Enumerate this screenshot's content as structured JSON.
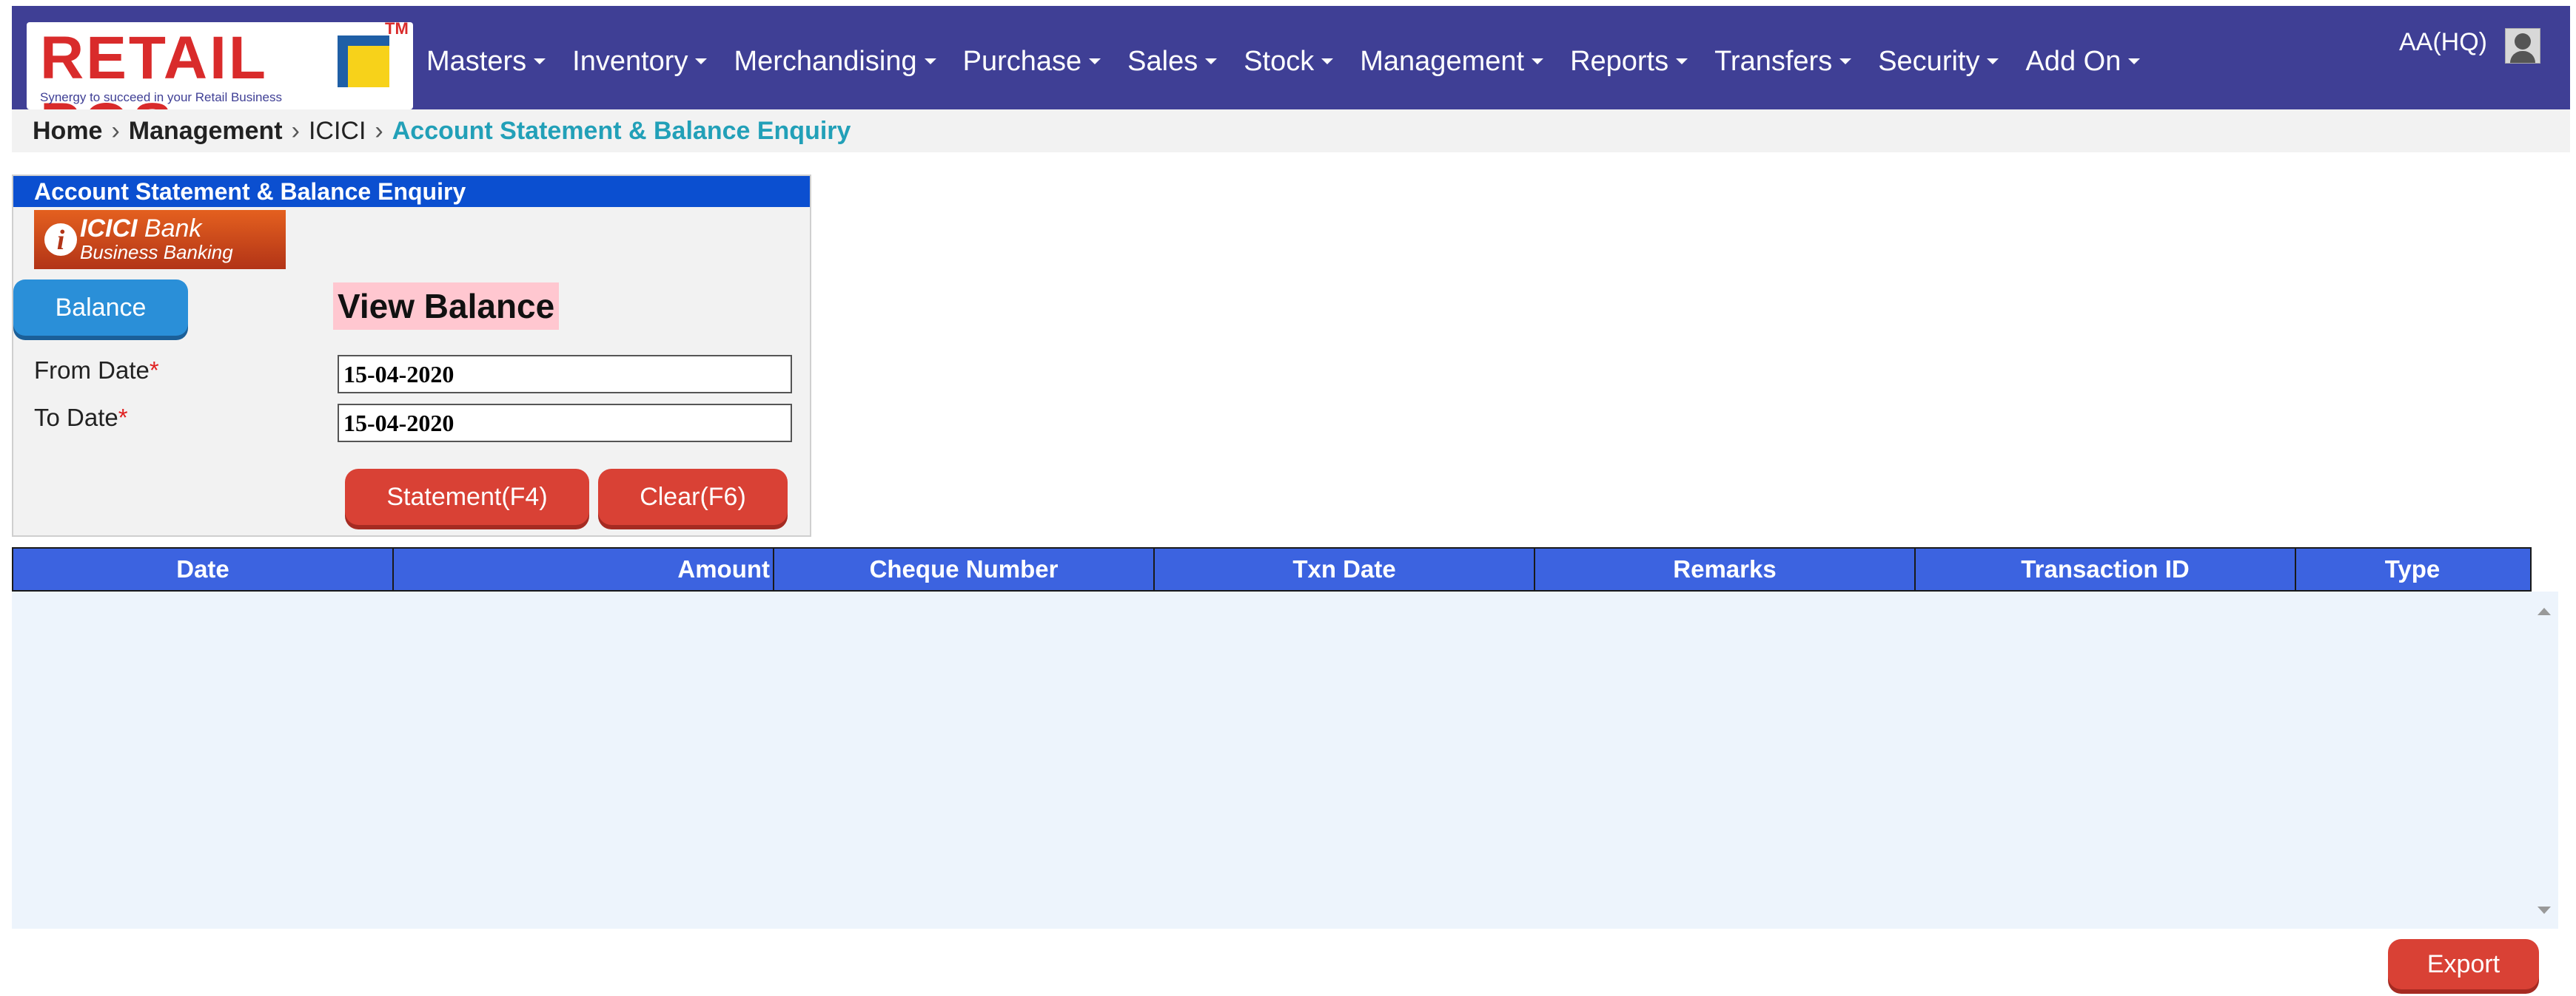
{
  "brand": {
    "logo_text": "RETAIL POS",
    "tm": "TM",
    "tagline": "Synergy to succeed in your Retail Business"
  },
  "nav": {
    "items": [
      "Masters",
      "Inventory",
      "Merchandising",
      "Purchase",
      "Sales",
      "Stock",
      "Management",
      "Reports",
      "Transfers",
      "Security",
      "Add On"
    ],
    "user": "AA(HQ)"
  },
  "breadcrumb": {
    "home": "Home",
    "section": "Management",
    "sub": "ICICI",
    "current": "Account Statement & Balance Enquiry",
    "separator": "›"
  },
  "panel": {
    "title": "Account Statement & Balance Enquiry",
    "bank_logo": {
      "name": "ICICI",
      "name_suffix": "Bank",
      "subtitle": "Business Banking",
      "glyph": "i"
    },
    "balance_button": "Balance",
    "view_balance": "View Balance",
    "from_label": "From Date",
    "to_label": "To Date",
    "required_mark": "*",
    "from_value": "15-04-2020",
    "to_value": "15-04-2020",
    "statement_button": "Statement(F4)",
    "clear_button": "Clear(F6)"
  },
  "table": {
    "columns": [
      "Date",
      "Amount",
      "Cheque Number",
      "Txn Date",
      "Remarks",
      "Transaction ID",
      "Type"
    ],
    "rows": []
  },
  "export_button": "Export",
  "colors": {
    "nav_bg": "#3f3f95",
    "panel_header": "#0b4fd0",
    "table_header": "#3c63e0",
    "button_red": "#d94135",
    "button_blue": "#2a8fd8",
    "breadcrumb_current": "#22a0b8",
    "highlight_pink": "#ffc7d0"
  }
}
